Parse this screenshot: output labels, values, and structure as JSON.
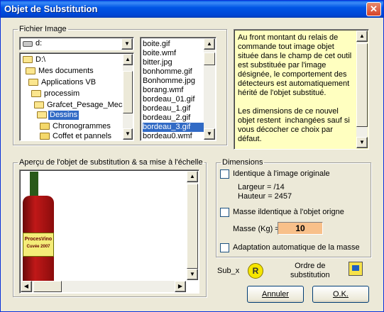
{
  "window": {
    "title": "Objet de Substitution",
    "close_glyph": "✕"
  },
  "file_group": {
    "legend": "Fichier Image",
    "drive": "d:",
    "directories": [
      "D:\\",
      "Mes documents",
      "Applications VB",
      "processim",
      "Grafcet_Pesage_Mecá",
      "Dessins",
      "Chronogrammes",
      "Coffet et pannels"
    ],
    "selected_directory": "Dessins",
    "files": [
      "boite.gif",
      "boite.wmf",
      "bitter.jpg",
      "bonhomme.gif",
      "Bonhomme.jpg",
      "borang.wmf",
      "bordeau_01.gif",
      "bordeau_1.gif",
      "bordeau_2.gif",
      "bordeau_3.gif",
      "bordeau0.wmf"
    ],
    "selected_file": "bordeau_3.gif"
  },
  "help": {
    "text": "Au front montant du relais de commande tout image objet située dans le champ de cet outil est substituée par l'image désignée, le comportement des détecteurs est automatiquement hérité de l'objet substitué.\n\nLes dimensions de ce nouvel objet restent  inchangées sauf si vous décocher ce choix par défaut."
  },
  "preview": {
    "legend": "Aperçu de l'objet de substitution & sa mise à l'échelle",
    "bottle_label_line1": "ProcesVino",
    "bottle_label_line2": "Cuvée 2007"
  },
  "dimensions": {
    "legend": "Dimensions",
    "identical_label": "Identique à l'image originale",
    "identical_checked": false,
    "width_label": "Largeur = /14",
    "height_label": "Hauteur = 2457",
    "mass_identical_label": "Masse ildentique à l'objet origne",
    "mass_identical_checked": false,
    "mass_label": "Masse (Kg) =",
    "mass_value": "10",
    "auto_label": "Adaptation automatique de la masse",
    "auto_checked": false
  },
  "footer": {
    "sub_label": "Sub_x",
    "r_icon_text": "R",
    "order_label": "Ordre de\nsubstitution",
    "cancel_label": "Annuler",
    "ok_label": "O.K."
  },
  "icons": {
    "r_icon": "relay-icon",
    "order_icon": "substitution-order-icon"
  },
  "colors": {
    "selection": "#316ac5",
    "help_bg": "#ffffc0",
    "mass_bg": "#f8c08a",
    "title_bar": "#0055e5"
  }
}
